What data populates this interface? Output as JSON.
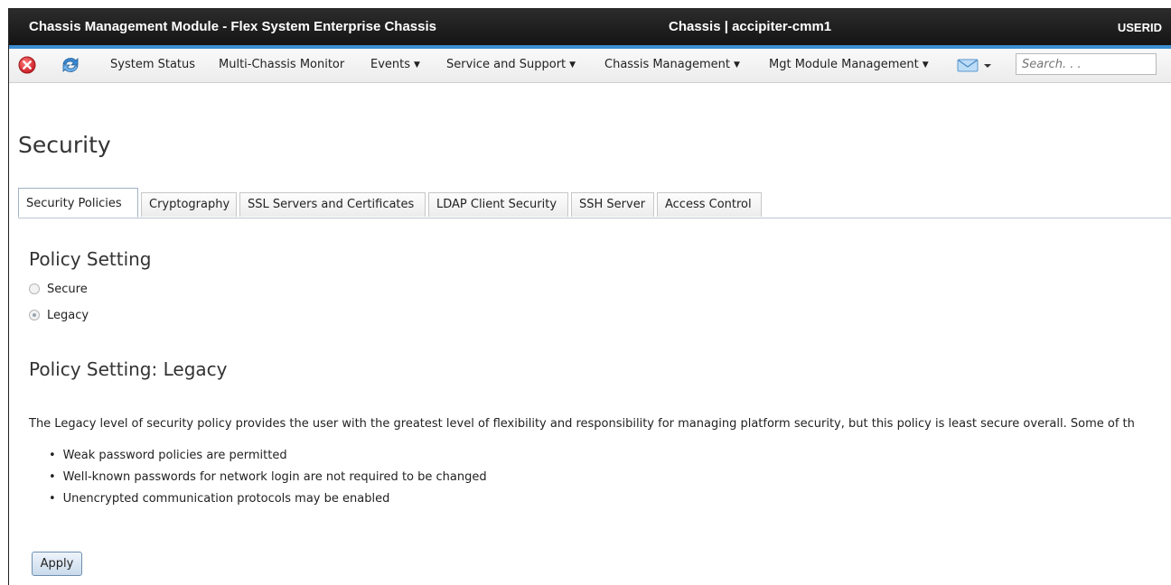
{
  "titlebar": {
    "app_title": "Chassis Management Module - Flex System Enterprise Chassis",
    "chassis_title": "Chassis | accipiter-cmm1",
    "user": "USERID"
  },
  "nav": {
    "items": [
      {
        "label": "System Status",
        "dropdown": false
      },
      {
        "label": "Multi-Chassis Monitor",
        "dropdown": false
      },
      {
        "label": "Events",
        "dropdown": true
      },
      {
        "label": "Service and Support",
        "dropdown": true
      },
      {
        "label": "Chassis Management",
        "dropdown": true
      },
      {
        "label": "Mgt Module Management",
        "dropdown": true
      }
    ],
    "search_placeholder": "Search. . ."
  },
  "page": {
    "title": "Security",
    "tabs": [
      {
        "label": "Security Policies",
        "active": true
      },
      {
        "label": "Cryptography",
        "active": false
      },
      {
        "label": "SSL Servers and Certificates",
        "active": false
      },
      {
        "label": "LDAP Client Security",
        "active": false
      },
      {
        "label": "SSH Server",
        "active": false
      },
      {
        "label": "Access Control",
        "active": false
      }
    ],
    "policy_heading": "Policy Setting",
    "options": [
      {
        "label": "Secure",
        "checked": false
      },
      {
        "label": "Legacy",
        "checked": true
      }
    ],
    "detail_heading": "Policy Setting: Legacy",
    "description": "The Legacy level of security policy provides the user with the greatest level of flexibility and responsibility for managing platform security, but this policy is least secure overall. Some of th",
    "bullets": [
      "Weak password policies are permitted",
      "Well-known passwords for network login are not required to be changed",
      "Unencrypted communication protocols may be enabled"
    ],
    "apply_label": "Apply"
  },
  "colors": {
    "accent": "#3b8dd1",
    "titlebar": "#1e1e1e",
    "close_icon": "#d9323a"
  },
  "icons": [
    "close-icon",
    "refresh-icon",
    "mail-icon",
    "chevron-down-icon"
  ]
}
